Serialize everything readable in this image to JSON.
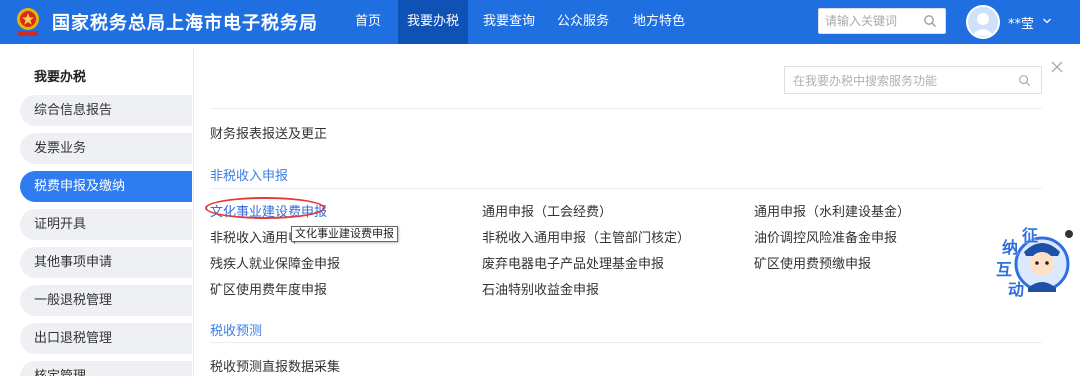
{
  "header": {
    "title": "国家税务总局上海市电子税务局",
    "nav": [
      "首页",
      "我要办税",
      "我要查询",
      "公众服务",
      "地方特色"
    ],
    "active_nav": 1,
    "search_placeholder": "请输入关键词",
    "user_name": "**莹"
  },
  "sidebar": {
    "title": "我要办税",
    "items": [
      "综合信息报告",
      "发票业务",
      "税费申报及缴纳",
      "证明开具",
      "其他事项申请",
      "一般退税管理",
      "出口退税管理",
      "核定管理"
    ],
    "active_index": 2
  },
  "main": {
    "search_placeholder": "在我要办税中搜索服务功能",
    "top_link": "财务报表报送及更正",
    "sections": [
      {
        "title": "非税收入申报",
        "rows": [
          [
            "文化事业建设费申报",
            "通用申报（工会经费）",
            "通用申报（水利建设基金）"
          ],
          [
            "非税收入通用申",
            "非税收入通用申报（主管部门核定）",
            "油价调控风险准备金申报"
          ],
          [
            "残疾人就业保障金申报",
            "废弃电器电子产品处理基金申报",
            "矿区使用费预缴申报"
          ],
          [
            "矿区使用费年度申报",
            "石油特别收益金申报",
            ""
          ]
        ]
      },
      {
        "title": "税收预测",
        "rows": [
          [
            "税收预测直报数据采集"
          ]
        ]
      }
    ],
    "tooltip": "文化事业建设费申报"
  },
  "float_badge": {
    "chars": [
      "征",
      "纳",
      "互",
      "动"
    ]
  },
  "colors": {
    "header_bg": "#1f6fe0",
    "nav_active": "#0f52b5",
    "sidebar_active": "#2f7bf0",
    "section_title": "#3a7ee8",
    "highlight_circle": "#e53935"
  }
}
